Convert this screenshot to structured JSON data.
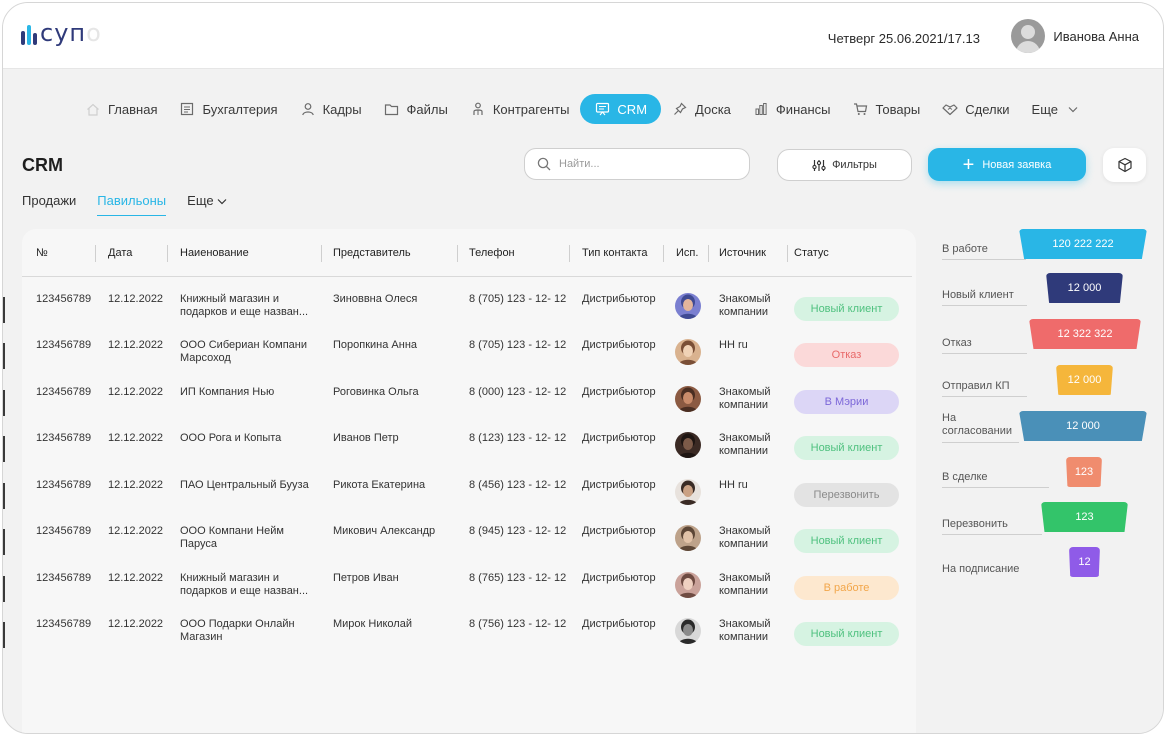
{
  "header": {
    "logo_text": "сyп",
    "logo_ghost": "o",
    "datetime": "Четверг 25.06.2021/17.13",
    "user_name": "Иванова Анна"
  },
  "nav": {
    "items": [
      {
        "label": "Главная",
        "icon": "home-icon"
      },
      {
        "label": "Бухгалтерия",
        "icon": "ledger-icon"
      },
      {
        "label": "Кадры",
        "icon": "person-icon"
      },
      {
        "label": "Файлы",
        "icon": "folder-icon"
      },
      {
        "label": "Контрагенты",
        "icon": "contractors-icon"
      },
      {
        "label": "CRM",
        "icon": "presentation-icon",
        "active": true
      },
      {
        "label": "Доска",
        "icon": "pin-icon"
      },
      {
        "label": "Финансы",
        "icon": "finance-chart-icon"
      },
      {
        "label": "Товары",
        "icon": "cart-icon"
      },
      {
        "label": "Сделки",
        "icon": "handshake-icon"
      },
      {
        "label": "Еще",
        "icon": "chevron-down-icon"
      }
    ]
  },
  "page": {
    "title": "CRM",
    "search_placeholder": "Найти...",
    "filters_label": "Фильтры",
    "new_button_label": "Новая заявка",
    "subtabs": [
      "Продажи",
      "Павильоны",
      "Еще"
    ],
    "active_subtab": "Павильоны"
  },
  "colors": {
    "accent": "#29b6e6",
    "brand_dark": "#2f3a7a"
  },
  "table": {
    "columns": [
      "№",
      "Дата",
      "Наиенование",
      "Представитель",
      "Телефон",
      "Тип контакта",
      "Исп.",
      "Источник",
      "Статус"
    ],
    "rows": [
      {
        "num": "123456789",
        "date": "12.12.2022",
        "name1": "Книжный магазин и",
        "name2": "подарков и еще назван...",
        "rep": "Зиноввна Олеся",
        "phone": "8 (705) 123 - 12- 12",
        "type": "Дистрибьютор",
        "src1": "Знакомый",
        "src2": "компании",
        "status": "Новый клиент",
        "status_kind": "new",
        "avatar": "blue"
      },
      {
        "num": "123456789",
        "date": "12.12.2022",
        "name1": "ООО Сибериан Компани",
        "name2": "Марсоход",
        "rep": "Поропкина Анна",
        "phone": "8 (705) 123 - 12- 12",
        "type": "Дистрибьютор",
        "src1": "HH ru",
        "src2": "",
        "status": "Отказ",
        "status_kind": "reject",
        "avatar": "tan"
      },
      {
        "num": "123456789",
        "date": "12.12.2022",
        "name1": "ИП Компания Нью",
        "name2": "",
        "rep": "Роговинка Ольга",
        "phone": "8 (000) 123 - 12- 12",
        "type": "Дистрибьютор",
        "src1": "Знакомый",
        "src2": "компании",
        "status": "В Мэрии",
        "status_kind": "mayor",
        "avatar": "brown"
      },
      {
        "num": "123456789",
        "date": "12.12.2022",
        "name1": "ООО Рога и Копыта",
        "name2": "",
        "rep": "Иванов Петр",
        "phone": "8 (123) 123 - 12- 12",
        "type": "Дистрибьютор",
        "src1": "Знакомый",
        "src2": "компании",
        "status": "Новый клиент",
        "status_kind": "new",
        "avatar": "dark"
      },
      {
        "num": "123456789",
        "date": "12.12.2022",
        "name1": "ПАО Центральный Бууза",
        "name2": "",
        "rep": "Рикота Екатерина",
        "phone": "8 (456) 123 - 12- 12",
        "type": "Дистрибьютор",
        "src1": "HH ru",
        "src2": "",
        "status": "Перезвонить",
        "status_kind": "callback",
        "avatar": "light"
      },
      {
        "num": "123456789",
        "date": "12.12.2022",
        "name1": "ООО Компани Нейм",
        "name2": "Паруса",
        "rep": "Микович Александр",
        "phone": "8 (945) 123 - 12- 12",
        "type": "Дистрибьютор",
        "src1": "Знакомый",
        "src2": "компании",
        "status": "Новый клиент",
        "status_kind": "new",
        "avatar": "tan2"
      },
      {
        "num": "123456789",
        "date": "12.12.2022",
        "name1": "Книжный магазин и",
        "name2": "подарков и еще назван...",
        "rep": "Петров Иван",
        "phone": "8 (765) 123 - 12- 12",
        "type": "Дистрибьютор",
        "src1": "Знакомый",
        "src2": "компании",
        "status": "В работе",
        "status_kind": "work",
        "avatar": "rose"
      },
      {
        "num": "123456789",
        "date": "12.12.2022",
        "name1": "ООО Подарки Онлайн",
        "name2": "Магазин",
        "rep": "Мирок Николай",
        "phone": "8 (756) 123 - 12- 12",
        "type": "Дистрибьютор",
        "src1": "Знакомый",
        "src2": "компании",
        "status": "Новый клиент",
        "status_kind": "new",
        "avatar": "bw"
      }
    ]
  },
  "stats": [
    {
      "label": "В работе",
      "value": "120 222 222",
      "color": "#29b6e6"
    },
    {
      "label": "Новый клиент",
      "value": "12 000",
      "color": "#2f3a7a"
    },
    {
      "label": "Отказ",
      "value": "12 322 322",
      "color": "#ef6b6b"
    },
    {
      "label": "Отправил КП",
      "value": "12 000",
      "color": "#f5b63b"
    },
    {
      "label": "На",
      "label2": "согласовании",
      "value": "12 000",
      "color": "#4a90b8"
    },
    {
      "label": "В сделке",
      "value": "123",
      "color": "#f08c6e"
    },
    {
      "label": "Перезвонить",
      "value": "123",
      "color": "#33c46a"
    },
    {
      "label": "На подписание",
      "value": "12",
      "color": "#8f5be8"
    }
  ]
}
